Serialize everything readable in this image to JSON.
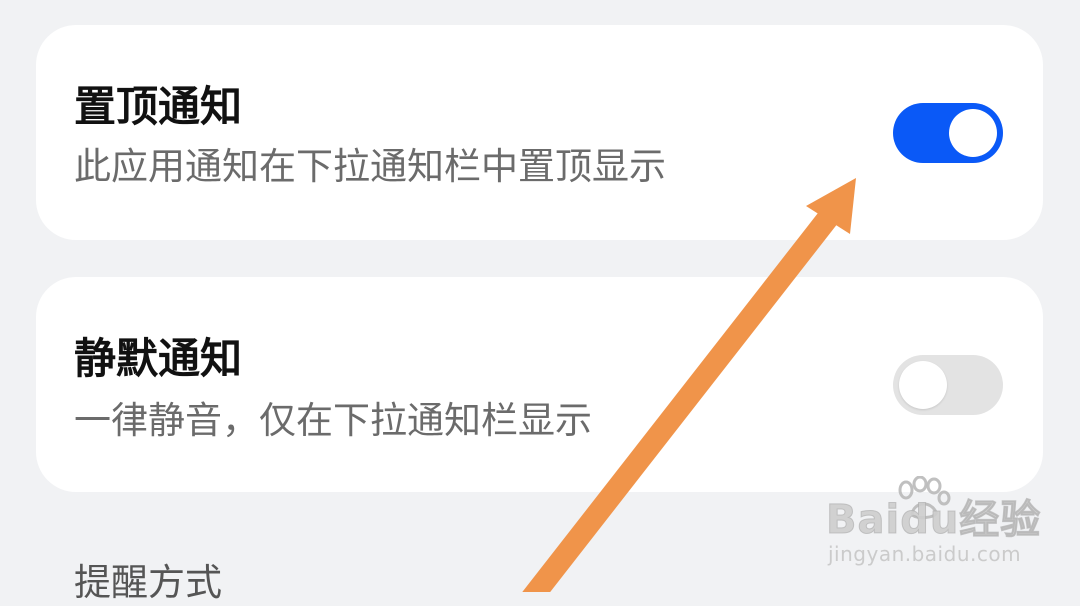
{
  "pin_notification": {
    "title": "置顶通知",
    "description": "此应用通知在下拉通知栏中置顶显示",
    "enabled": true
  },
  "silent_notification": {
    "title": "静默通知",
    "description": "一律静音，仅在下拉通知栏显示",
    "enabled": false
  },
  "alert_method_header": "提醒方式",
  "watermark": {
    "brand": "Baidu经验",
    "url": "jingyan.baidu.com"
  },
  "colors": {
    "background": "#f1f2f4",
    "card": "#ffffff",
    "toggle_on": "#0a59f7",
    "toggle_off": "#e3e3e3",
    "annotation_arrow": "#f0944a"
  },
  "annotation": "orange-arrow-pointing-to-pin-toggle"
}
